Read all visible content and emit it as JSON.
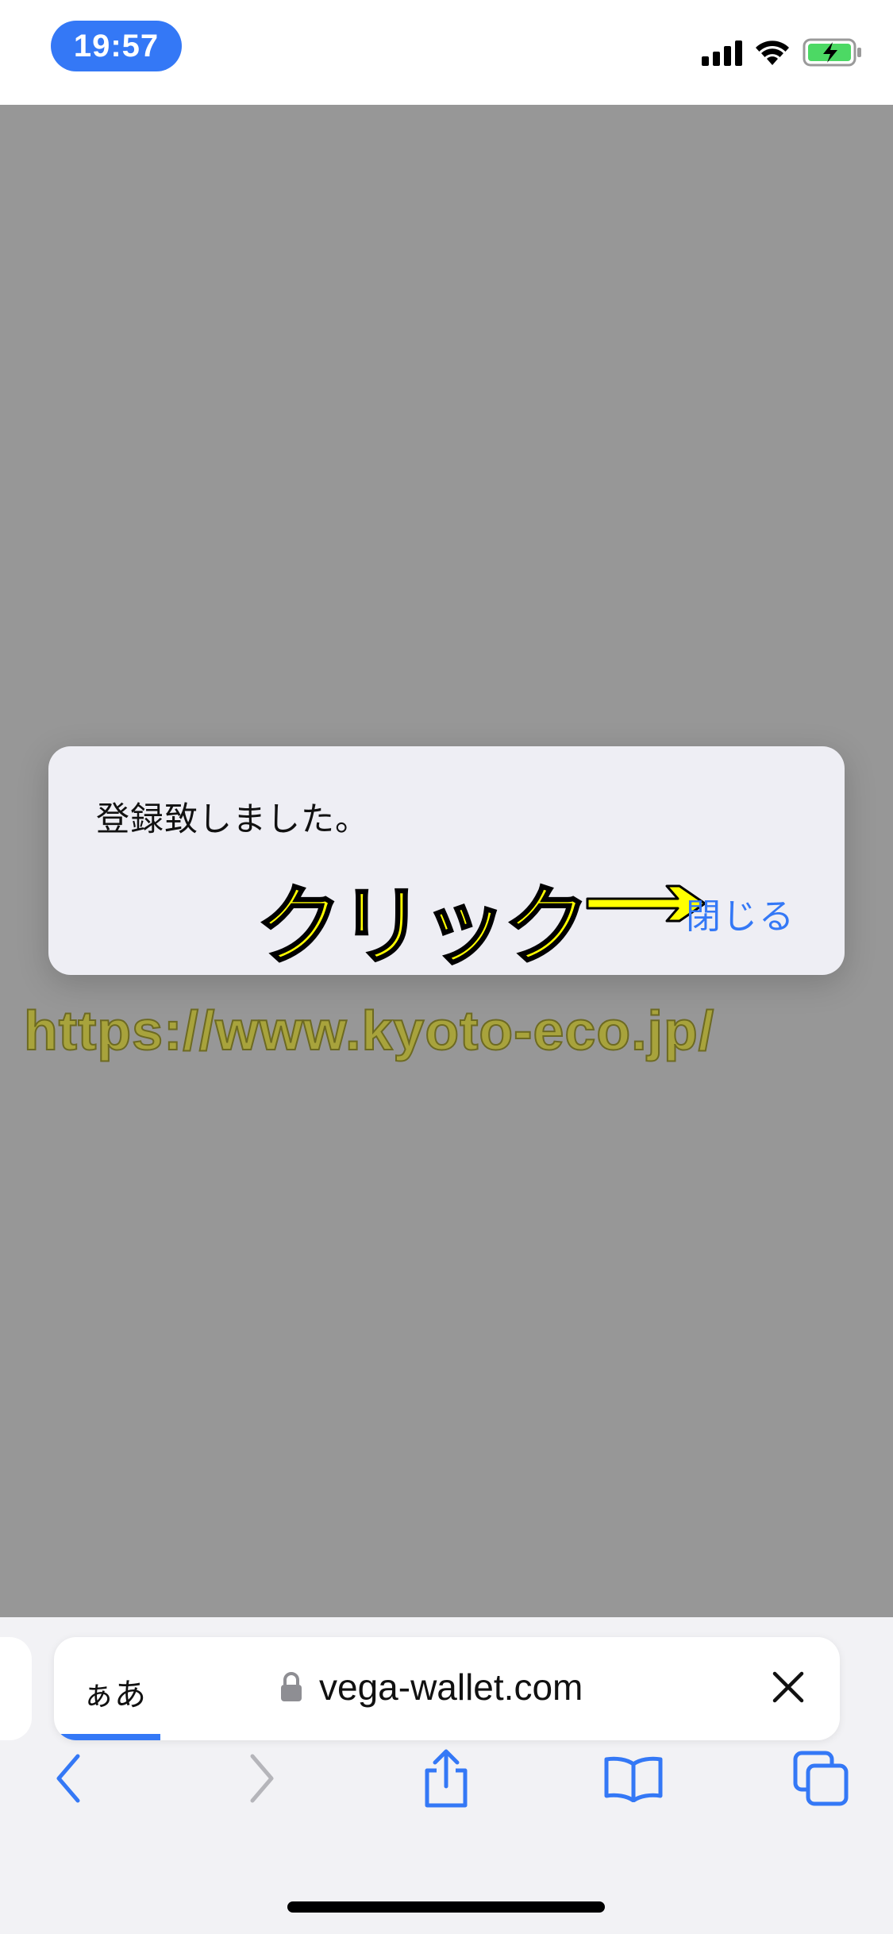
{
  "status_bar": {
    "time": "19:57",
    "icons": [
      "cellular-signal-icon",
      "wifi-icon",
      "battery-charging-icon"
    ]
  },
  "alert": {
    "message": "登録致しました。",
    "close_label": "閉じる"
  },
  "annotation": {
    "click_label": "クリック",
    "arrow": "→"
  },
  "watermark": {
    "text": "https://www.kyoto-eco.jp/"
  },
  "browser": {
    "aa_label": "ぁあ",
    "url": "vega-wallet.com",
    "toolbar": [
      "back-icon",
      "forward-icon",
      "share-icon",
      "bookmarks-icon",
      "tabs-icon"
    ]
  },
  "colors": {
    "accent": "#3478f6",
    "dim_overlay": "#979797",
    "annotation_yellow": "#ffff00",
    "battery_green": "#4cd964"
  }
}
